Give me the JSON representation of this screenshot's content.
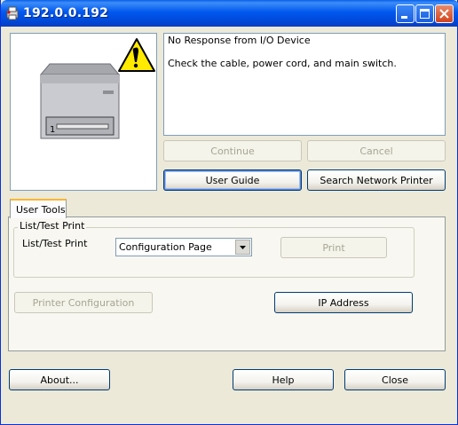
{
  "window": {
    "title": "192.0.0.192",
    "accent_color": "#0058ee"
  },
  "message": {
    "line1": "No Response from I/O Device",
    "line2": "Check the cable, power cord, and main switch."
  },
  "buttons": {
    "continue": "Continue",
    "cancel": "Cancel",
    "user_guide": "User Guide",
    "search_network_printer": "Search Network Printer",
    "print": "Print",
    "printer_configuration": "Printer Configuration",
    "ip_address": "IP Address",
    "about": "About...",
    "help": "Help",
    "close": "Close"
  },
  "tabs": {
    "user_tools": "User Tools"
  },
  "list_test_print": {
    "group_label": "List/Test Print",
    "field_label": "List/Test Print",
    "selected_option": "Configuration Page"
  },
  "printer_image": {
    "tray_number": "1"
  },
  "icons": [
    "printer-app-icon",
    "minimize-icon",
    "maximize-icon",
    "close-icon",
    "printer-icon",
    "warning-icon",
    "dropdown-arrow-icon"
  ]
}
